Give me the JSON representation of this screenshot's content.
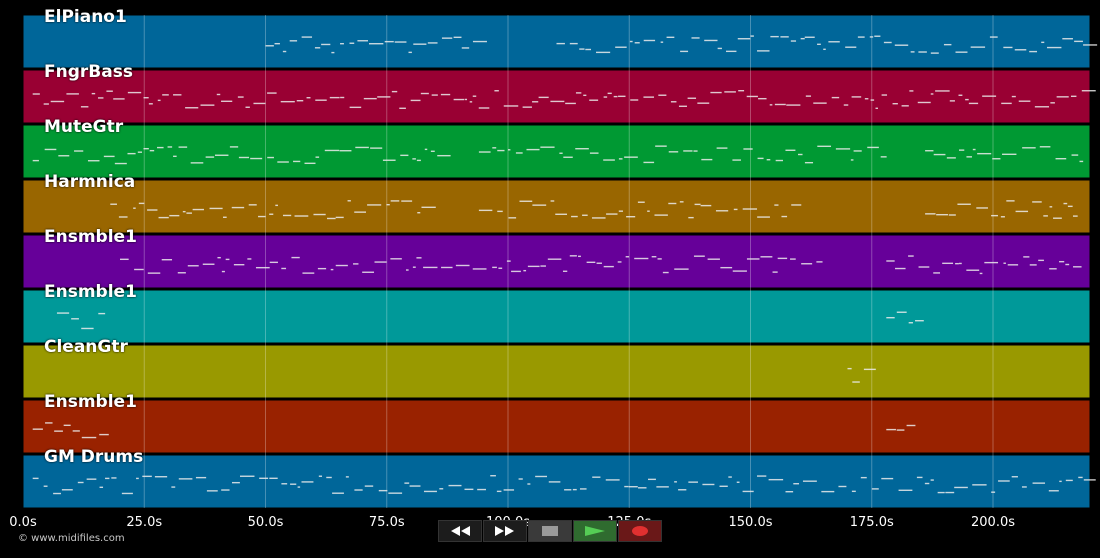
{
  "tracks": [
    {
      "name": "ElPiano1",
      "color": "#006699"
    },
    {
      "name": "FngrBass",
      "color": "#990033"
    },
    {
      "name": "MuteGtr",
      "color": "#009933"
    },
    {
      "name": "Harmnica",
      "color": "#996600"
    },
    {
      "name": "Ensmble1",
      "color": "#660099"
    },
    {
      "name": "Ensmble1",
      "color": "#009999"
    },
    {
      "name": "CleanGtr",
      "color": "#999900"
    },
    {
      "name": "Ensmble1",
      "color": "#992200"
    },
    {
      "name": "GM Drums",
      "color": "#006699"
    }
  ],
  "timeline": {
    "ticks": [
      "0.0s",
      "25.0s",
      "50.0s",
      "75.0s",
      "100.0s",
      "125.0s",
      "150.0s",
      "175.0s",
      "200.0s"
    ],
    "tick_values": [
      0,
      25,
      50,
      75,
      100,
      125,
      150,
      175,
      200
    ],
    "max_seconds": 220
  },
  "transport": {
    "rewind_icon": "rewind-icon",
    "ffwd_icon": "fast-forward-icon",
    "stop_icon": "stop-icon",
    "play_icon": "play-icon",
    "record_icon": "record-icon",
    "record_color": "#e03030",
    "play_color": "#55cc55"
  },
  "copyright": "© www.midifiles.com"
}
